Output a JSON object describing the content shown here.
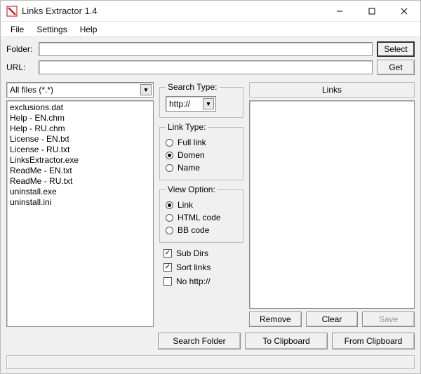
{
  "window": {
    "title": "Links Extractor 1.4"
  },
  "menu": {
    "file": "File",
    "settings": "Settings",
    "help": "Help"
  },
  "labels": {
    "folder": "Folder:",
    "url": "URL:"
  },
  "inputs": {
    "folder": "",
    "url": ""
  },
  "buttons": {
    "select": "Select",
    "get": "Get",
    "remove": "Remove",
    "clear": "Clear",
    "save": "Save",
    "search_folder": "Search Folder",
    "to_clipboard": "To Clipboard",
    "from_clipboard": "From Clipboard"
  },
  "filter": {
    "selected": "All files (*.*)"
  },
  "files": [
    "exclusions.dat",
    "Help - EN.chm",
    "Help - RU.chm",
    "License - EN.txt",
    "License - RU.txt",
    "LinksExtractor.exe",
    "ReadMe - EN.txt",
    "ReadMe - RU.txt",
    "uninstall.exe",
    "uninstall.ini"
  ],
  "search_type": {
    "legend": "Search Type:",
    "value": "http://"
  },
  "link_type": {
    "legend": "Link Type:",
    "options": [
      "Full link",
      "Domen",
      "Name"
    ],
    "selected": "Domen"
  },
  "view_option": {
    "legend": "View Option:",
    "options": [
      "Link",
      "HTML code",
      "BB code"
    ],
    "selected": "Link"
  },
  "checks": {
    "sub_dirs": {
      "label": "Sub Dirs",
      "checked": true
    },
    "sort_links": {
      "label": "Sort links",
      "checked": true
    },
    "no_http": {
      "label": "No http://",
      "checked": false
    }
  },
  "links": {
    "header": "Links"
  }
}
